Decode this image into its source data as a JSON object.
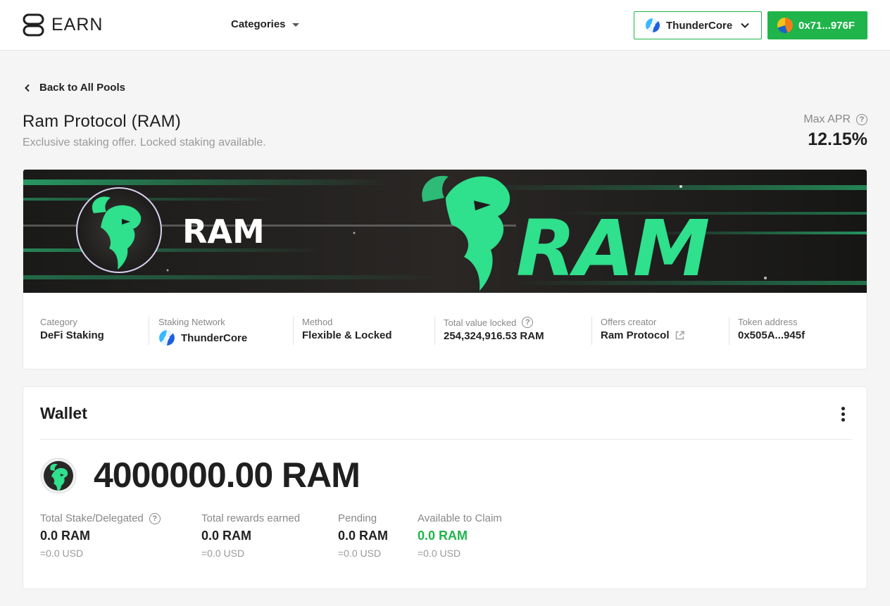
{
  "header": {
    "brand": "EARN",
    "categories_label": "Categories",
    "network_label": "ThunderCore",
    "wallet_address": "0x71...976F"
  },
  "nav": {
    "back_label": "Back to All Pools"
  },
  "pool": {
    "title": "Ram Protocol (RAM)",
    "subtitle": "Exclusive staking offer. Locked staking available.",
    "max_apr_label": "Max APR",
    "max_apr_value": "12.15%",
    "banner_name": "RAM",
    "banner_wordmark": "RAM",
    "stats": [
      {
        "label": "Category",
        "value": "DeFi Staking"
      },
      {
        "label": "Staking Network",
        "value": "ThunderCore"
      },
      {
        "label": "Method",
        "value": "Flexible & Locked"
      },
      {
        "label": "Total value locked",
        "value": "254,324,916.53 RAM"
      },
      {
        "label": "Offers creator",
        "value": "Ram Protocol"
      },
      {
        "label": "Token address",
        "value": "0x505A...945f"
      }
    ]
  },
  "wallet": {
    "title": "Wallet",
    "balance": "4000000.00 RAM",
    "stats": [
      {
        "label": "Total Stake/Delegated",
        "value": "0.0 RAM",
        "usd": "=0.0 USD"
      },
      {
        "label": "Total rewards earned",
        "value": "0.0 RAM",
        "usd": "=0.0 USD"
      },
      {
        "label": "Pending",
        "value": "0.0 RAM",
        "usd": "=0.0 USD"
      },
      {
        "label": "Available to Claim",
        "value": "0.0 RAM",
        "usd": "=0.0 USD"
      }
    ]
  },
  "colors": {
    "accent_green": "#1fb54a",
    "ram_green": "#2fe08c",
    "banner_dark": "#1c1a19"
  },
  "icons": {
    "logo": "earn-logo-icon",
    "network": "thundercore-icon",
    "question": "question-circle-icon",
    "external": "external-link-icon",
    "menu": "kebab-menu-icon"
  }
}
